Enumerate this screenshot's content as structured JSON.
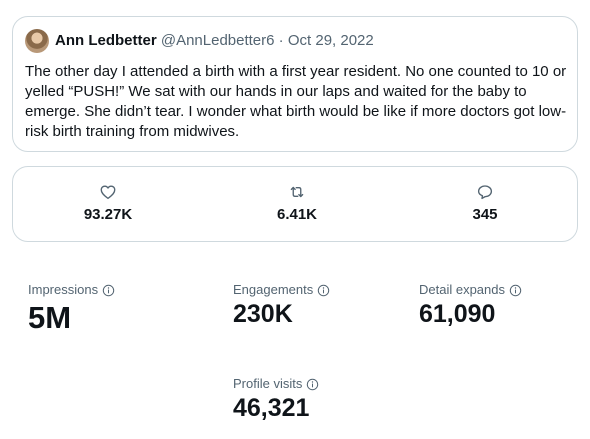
{
  "tweet": {
    "author_name": "Ann Ledbetter",
    "author_handle": "@AnnLedbetter6",
    "separator": "·",
    "date": "Oct 29, 2022",
    "text": "The other day I attended a birth with a first year resident. No one counted to 10 or yelled “PUSH!” We sat with our hands in our laps and waited for the baby to emerge. She didn’t tear. I wonder what birth would  be like if more doctors got low-risk birth training from midwives."
  },
  "engagement_bar": {
    "likes": {
      "icon": "heart-icon",
      "value": "93.27K"
    },
    "retweets": {
      "icon": "retweet-icon",
      "value": "6.41K"
    },
    "replies": {
      "icon": "reply-icon",
      "value": "345"
    }
  },
  "analytics": {
    "impressions": {
      "label": "Impressions",
      "value": "5M"
    },
    "engagements": {
      "label": "Engagements",
      "value": "230K"
    },
    "detail_expands": {
      "label": "Detail expands",
      "value": "61,090"
    },
    "profile_visits": {
      "label": "Profile visits",
      "value": "46,321"
    }
  },
  "colors": {
    "border": "#cfd9de",
    "secondary_text": "#536471",
    "primary_text": "#0f1419",
    "icon": "#536471"
  }
}
